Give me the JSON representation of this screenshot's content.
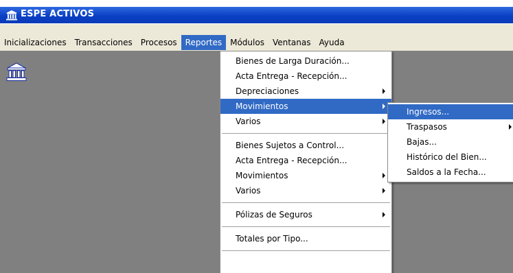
{
  "window": {
    "title": "ESPE ACTIVOS",
    "title_icon": "building-icon",
    "colors": {
      "title_bar": "#0a3fc4",
      "menubar": "#ece9d8",
      "highlight": "#316ac5",
      "client": "#808080"
    }
  },
  "menubar": {
    "items": [
      {
        "label": "Inicializaciones"
      },
      {
        "label": "Transacciones"
      },
      {
        "label": "Procesos"
      },
      {
        "label": "Reportes",
        "active": true
      },
      {
        "label": "Módulos"
      },
      {
        "label": "Ventanas"
      },
      {
        "label": "Ayuda"
      }
    ]
  },
  "reportes_menu": {
    "items": [
      {
        "label": "Bienes de Larga Duración..."
      },
      {
        "label": "Acta Entrega - Recepción..."
      },
      {
        "label": "Depreciaciones",
        "submenu": true
      },
      {
        "label": "Movimientos",
        "submenu": true,
        "highlighted": true
      },
      {
        "label": "Varios",
        "submenu": true
      },
      {
        "label": "Bienes Sujetos a Control..."
      },
      {
        "label": "Acta Entrega - Recepción..."
      },
      {
        "label": "Movimientos",
        "submenu": true
      },
      {
        "label": "Varios",
        "submenu": true
      },
      {
        "label": "Pólizas de Seguros",
        "submenu": true
      },
      {
        "label": "Totales por Tipo..."
      }
    ]
  },
  "movimientos_submenu": {
    "items": [
      {
        "label": "Ingresos...",
        "highlighted": true
      },
      {
        "label": "Traspasos",
        "submenu": true
      },
      {
        "label": "Bajas..."
      },
      {
        "label": "Histórico del Bien..."
      },
      {
        "label": "Saldos a la Fecha..."
      }
    ]
  },
  "client": {
    "app_icon": "building-icon"
  }
}
